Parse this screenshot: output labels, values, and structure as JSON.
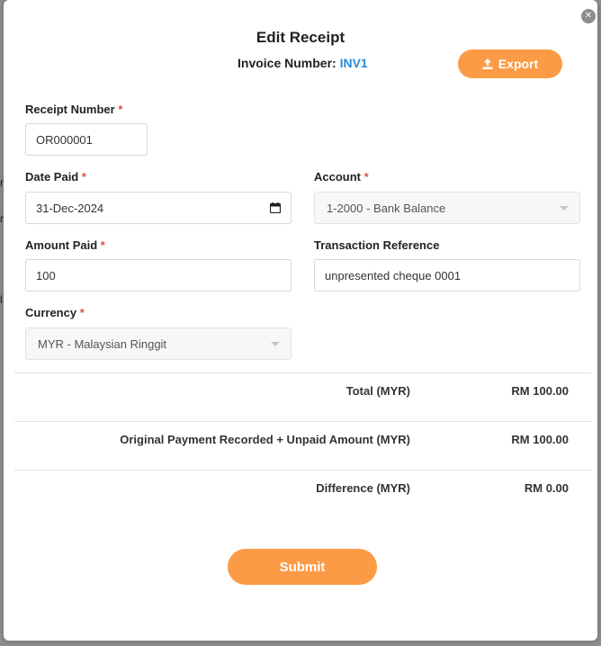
{
  "background_peek": [
    "n",
    "n",
    "l"
  ],
  "modal": {
    "title": "Edit Receipt",
    "invoice_label": "Invoice Number:",
    "invoice_number": "INV1",
    "export_label": "Export",
    "close_icon": "close-icon"
  },
  "form": {
    "receipt_number": {
      "label": "Receipt Number",
      "required": "*",
      "value": "OR000001"
    },
    "date_paid": {
      "label": "Date Paid",
      "required": "*",
      "value": "31-Dec-2024"
    },
    "account": {
      "label": "Account",
      "required": "*",
      "value": "1-2000 - Bank Balance"
    },
    "amount_paid": {
      "label": "Amount Paid",
      "required": "*",
      "value": "100"
    },
    "transaction_reference": {
      "label": "Transaction Reference",
      "value": "unpresented cheque 0001"
    },
    "currency": {
      "label": "Currency",
      "required": "*",
      "value": "MYR - Malaysian Ringgit"
    }
  },
  "summary": [
    {
      "label": "Total (MYR)",
      "value": "RM 100.00"
    },
    {
      "label": "Original Payment Recorded + Unpaid Amount (MYR)",
      "value": "RM 100.00"
    },
    {
      "label": "Difference (MYR)",
      "value": "RM 0.00"
    }
  ],
  "submit_label": "Submit",
  "colors": {
    "accent": "#fb9b45",
    "link": "#2a8bd8",
    "required": "#d9534f"
  }
}
